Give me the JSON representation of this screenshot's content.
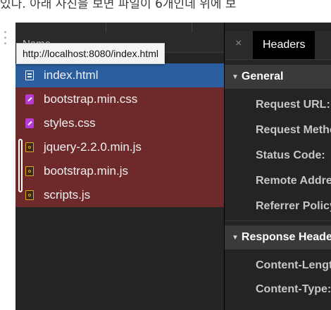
{
  "caption": "있다. 아래 사진을 보면 파일이 6개인데 위에 보",
  "list": {
    "column_name": "Name",
    "tooltip": "http://localhost:8080/index.html",
    "rows": [
      {
        "label": "index.html",
        "icon": "document-icon"
      },
      {
        "label": "bootstrap.min.css",
        "icon": "css-file-icon"
      },
      {
        "label": "styles.css",
        "icon": "css-file-icon"
      },
      {
        "label": "jquery-2.2.0.min.js",
        "icon": "js-file-icon"
      },
      {
        "label": "bootstrap.min.js",
        "icon": "js-file-icon"
      },
      {
        "label": "scripts.js",
        "icon": "js-file-icon"
      }
    ]
  },
  "detail": {
    "close_glyph": "×",
    "active_tab": "Headers",
    "general": {
      "title": "General",
      "fields": [
        "Request URL:",
        "Request Method:",
        "Status Code:",
        "Remote Address:",
        "Referrer Policy:"
      ]
    },
    "response": {
      "title": "Response Headers",
      "fields": [
        "Content-Length:",
        "Content-Type:"
      ]
    }
  },
  "colors": {
    "panel_bg": "#242424",
    "selected_row": "#2a5e9e",
    "uncached_row": "#6e2a2a",
    "css_icon": "#b63ad3",
    "js_icon": "#e2a526"
  }
}
